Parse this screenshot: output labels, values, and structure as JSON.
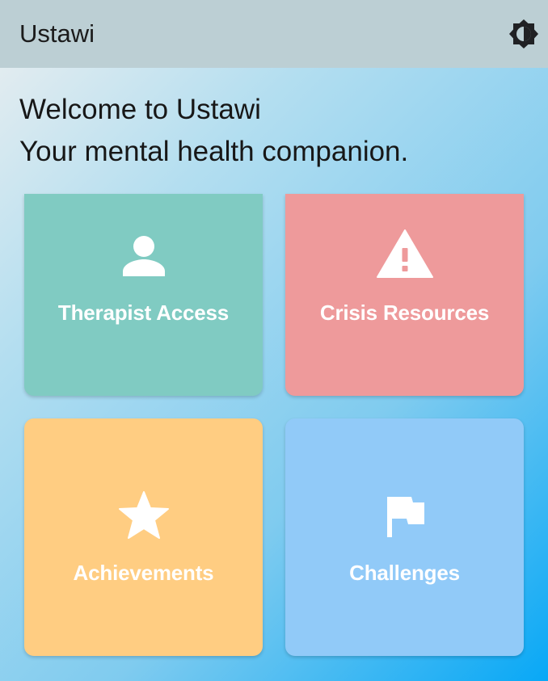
{
  "app": {
    "title": "Ustawi",
    "theme_icon": "brightness-icon"
  },
  "welcome": {
    "line1": "Welcome to Ustawi",
    "line2": "Your mental health companion."
  },
  "tiles": [
    {
      "label": "Therapist Access",
      "icon": "person-icon",
      "color": "#80cbc2"
    },
    {
      "label": "Crisis Resources",
      "icon": "warning-icon",
      "color": "#ee9a9b"
    },
    {
      "label": "Achievements",
      "icon": "star-icon",
      "color": "#ffcd82"
    },
    {
      "label": "Challenges",
      "icon": "flag-icon",
      "color": "#91caf8"
    }
  ],
  "colors": {
    "appbar": "#bccfd4",
    "gradient_start": "#eceff0",
    "gradient_end": "#08a8f6",
    "text": "#171717"
  }
}
